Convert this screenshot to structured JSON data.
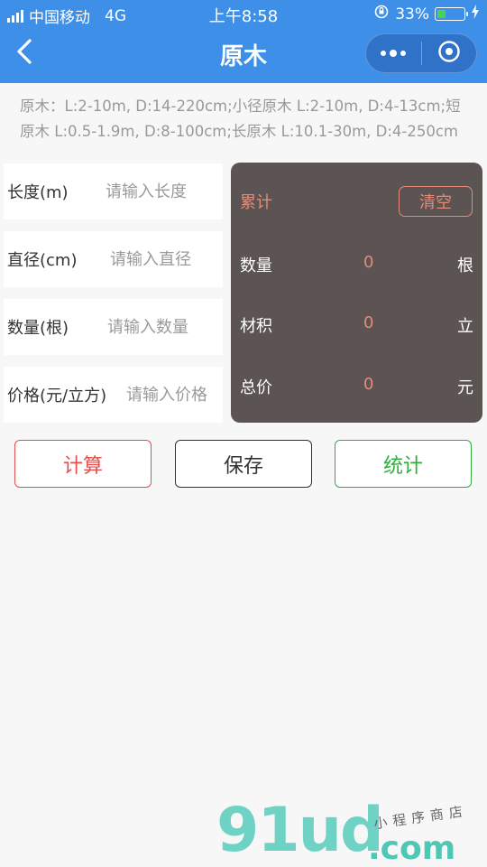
{
  "status_bar": {
    "carrier": "中国移动",
    "network": "4G",
    "time": "上午8:58",
    "battery_percent": "33%",
    "battery_level": 0.33
  },
  "nav": {
    "title": "原木",
    "back_icon": "chevron-left-icon",
    "more_icon": "more-dots-icon",
    "close_icon": "target-circle-icon"
  },
  "notice": "原木：L:2-10m, D:14-220cm;小径原木 L:2-10m, D:4-13cm;短原木 L:0.5-1.9m, D:8-100cm;长原木 L:10.1-30m, D:4-250cm",
  "form": {
    "fields": [
      {
        "label": "长度(m)",
        "placeholder": "请输入长度",
        "value": ""
      },
      {
        "label": "直径(cm)",
        "placeholder": "请输入直径",
        "value": ""
      },
      {
        "label": "数量(根)",
        "placeholder": "请输入数量",
        "value": ""
      },
      {
        "label": "价格(元/立方)",
        "placeholder": "请输入价格",
        "value": ""
      }
    ]
  },
  "summary": {
    "title": "累计",
    "clear_label": "清空",
    "rows": [
      {
        "label": "数量",
        "value": "0",
        "unit": "根"
      },
      {
        "label": "材积",
        "value": "0",
        "unit": "立"
      },
      {
        "label": "总价",
        "value": "0",
        "unit": "元"
      }
    ]
  },
  "actions": {
    "calculate": "计算",
    "save": "保存",
    "stats": "统计"
  },
  "watermark": {
    "logo": "91ud",
    "domain": ".com",
    "subtitle": "小程序商店"
  },
  "colors": {
    "nav_bg": "#3d8fe8",
    "panel_bg": "#5b5453",
    "accent_salmon": "#e58a78",
    "calc_red": "#e0504d",
    "stats_green": "#2fae3c"
  }
}
